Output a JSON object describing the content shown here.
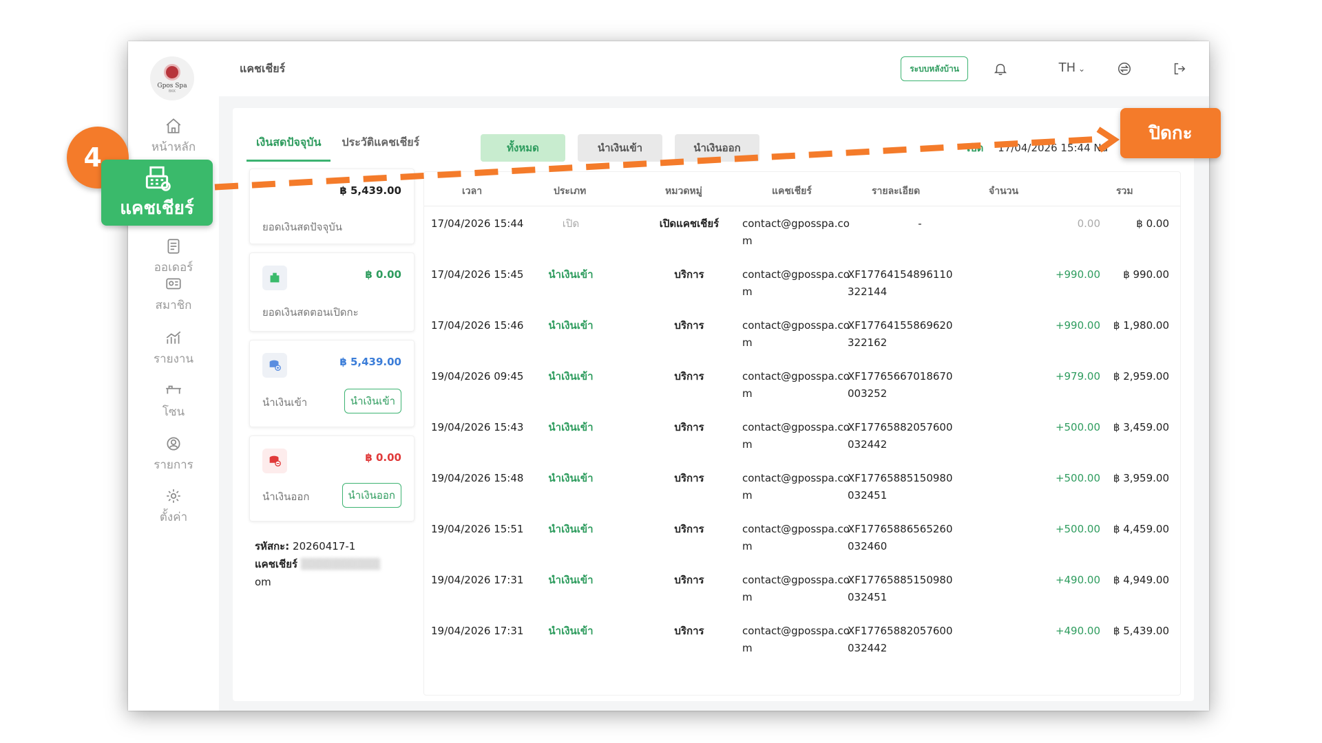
{
  "sidebar": {
    "logo_name": "Gpos Spa",
    "logo_sub": "BKK",
    "items": [
      {
        "label": "หน้าหลัก",
        "icon": "home-icon"
      },
      {
        "label": "แคชเชียร์",
        "icon": "cash-register-icon"
      },
      {
        "label": "ออเดอร์",
        "icon": "order-list-icon"
      },
      {
        "label": "สมาชิก",
        "icon": "member-card-icon"
      },
      {
        "label": "รายงาน",
        "icon": "report-chart-icon"
      },
      {
        "label": "โซน",
        "icon": "bed-zone-icon"
      },
      {
        "label": "รายการ",
        "icon": "service-list-icon"
      },
      {
        "label": "ตั้งค่า",
        "icon": "settings-gear-icon"
      }
    ]
  },
  "topbar": {
    "title": "แคชเชียร์",
    "system_button": "ระบบหลังบ้าน",
    "language": "TH"
  },
  "tabs": [
    "เงินสดปัจจุบัน",
    "ประวัติแคชเชียร์"
  ],
  "filters": [
    "ทั้งหมด",
    "นำเงินเข้า",
    "นำเงินออก"
  ],
  "open_info": {
    "label": "เปิด",
    "value": "17/04/2026 15:44 Nd"
  },
  "cards": {
    "current": {
      "value": "฿ 5,439.00",
      "label": "ยอดเงินสดปัจจุบัน"
    },
    "opening": {
      "value": "฿ 0.00",
      "label": "ยอดเงินสดตอนเปิดกะ"
    },
    "cash_in": {
      "value": "฿ 5,439.00",
      "label": "นำเงินเข้า",
      "button": "นำเงินเข้า"
    },
    "cash_out": {
      "value": "฿ 0.00",
      "label": "นำเงินออก",
      "button": "นำเงินออก"
    }
  },
  "meta": {
    "shift_label": "รหัสกะ:",
    "shift_code": "20260417-1",
    "cashier_label": "แคชเชียร์",
    "cashier_tail": "om"
  },
  "table": {
    "headers": [
      "เวลา",
      "ประเภท",
      "หมวดหมู่",
      "แคชเชียร์",
      "รายละเอียด",
      "จำนวน",
      "รวม"
    ],
    "rows": [
      {
        "date": "17/04/2026 15:44",
        "type": "เปิด",
        "category": "เปิดแคชเชียร์",
        "cashier": "contact@gposspa.com",
        "detail": "-",
        "amount": "0.00",
        "total": "฿ 0.00"
      },
      {
        "date": "17/04/2026 15:45",
        "type": "นำเงินเข้า",
        "category": "บริการ",
        "cashier": "contact@gposspa.com",
        "detail": "XF17764154896110322144",
        "amount": "+990.00",
        "total": "฿ 990.00"
      },
      {
        "date": "17/04/2026 15:46",
        "type": "นำเงินเข้า",
        "category": "บริการ",
        "cashier": "contact@gposspa.com",
        "detail": "XF17764155869620322162",
        "amount": "+990.00",
        "total": "฿ 1,980.00"
      },
      {
        "date": "19/04/2026 09:45",
        "type": "นำเงินเข้า",
        "category": "บริการ",
        "cashier": "contact@gposspa.com",
        "detail": "XF17765667018670003252",
        "amount": "+979.00",
        "total": "฿ 2,959.00"
      },
      {
        "date": "19/04/2026 15:43",
        "type": "นำเงินเข้า",
        "category": "บริการ",
        "cashier": "contact@gposspa.com",
        "detail": "XF17765882057600032442",
        "amount": "+500.00",
        "total": "฿ 3,459.00"
      },
      {
        "date": "19/04/2026 15:48",
        "type": "นำเงินเข้า",
        "category": "บริการ",
        "cashier": "contact@gposspa.com",
        "detail": "XF17765885150980032451",
        "amount": "+500.00",
        "total": "฿ 3,959.00"
      },
      {
        "date": "19/04/2026 15:51",
        "type": "นำเงินเข้า",
        "category": "บริการ",
        "cashier": "contact@gposspa.com",
        "detail": "XF17765886565260032460",
        "amount": "+500.00",
        "total": "฿ 4,459.00"
      },
      {
        "date": "19/04/2026 17:31",
        "type": "นำเงินเข้า",
        "category": "บริการ",
        "cashier": "contact@gposspa.com",
        "detail": "XF17765885150980032451",
        "amount": "+490.00",
        "total": "฿ 4,949.00"
      },
      {
        "date": "19/04/2026 17:31",
        "type": "นำเงินเข้า",
        "category": "บริการ",
        "cashier": "contact@gposspa.com",
        "detail": "XF17765882057600032442",
        "amount": "+490.00",
        "total": "฿ 5,439.00"
      }
    ]
  },
  "overlay": {
    "step": "4.",
    "highlight_label": "แคชเชียร์",
    "close_shift": "ปิดกะ",
    "accent_orange": "#f47b2a",
    "accent_green": "#3aba6b"
  }
}
